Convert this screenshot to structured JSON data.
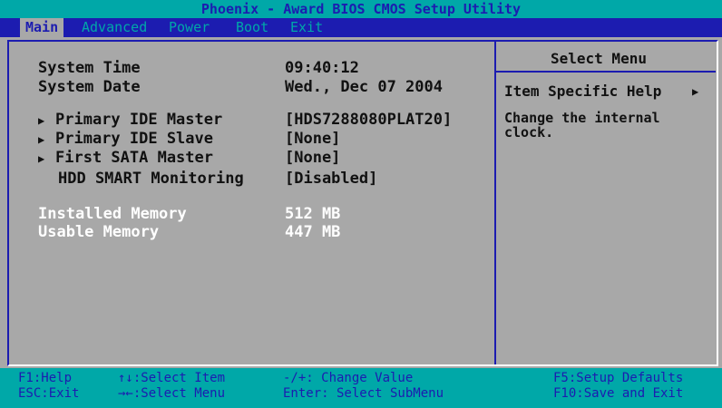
{
  "title": "Phoenix - Award BIOS CMOS Setup Utility",
  "menu": [
    "Main",
    "Advanced",
    "Power",
    "Boot",
    "Exit"
  ],
  "main": {
    "items": [
      {
        "label": "System Time",
        "value": "09:40:12"
      },
      {
        "label": "System Date",
        "value": "Wed., Dec 07 2004"
      },
      {
        "label": "Primary IDE Master",
        "value": "[HDS7288080PLAT20]"
      },
      {
        "label": "Primary IDE Slave",
        "value": "[None]"
      },
      {
        "label": "First SATA Master",
        "value": "[None]"
      },
      {
        "label": "HDD SMART Monitoring",
        "value": "[Disabled]"
      },
      {
        "label": "Installed Memory",
        "value": "512 MB"
      },
      {
        "label": "Usable Memory",
        "value": "447 MB"
      }
    ]
  },
  "help": {
    "select_menu": "Select Menu",
    "item_specific": "Item Specific Help",
    "text": "Change the internal clock."
  },
  "status": {
    "f1": "F1:Help",
    "esc": "ESC:Exit",
    "select_item": "↑↓:Select Item",
    "select_menu": "→←:Select Menu",
    "change_value": "-/+: Change Value",
    "enter": "Enter: Select SubMenu",
    "f5": "F5:Setup Defaults",
    "f10": "F10:Save and Exit"
  },
  "icons": {
    "submenu": "right-triangle",
    "help_arrow": "right-triangle"
  },
  "colors": {
    "background": "#a8a8a8",
    "cyan": "#00a8a8",
    "blue": "#1c1cb0",
    "white": "#ffffff"
  }
}
